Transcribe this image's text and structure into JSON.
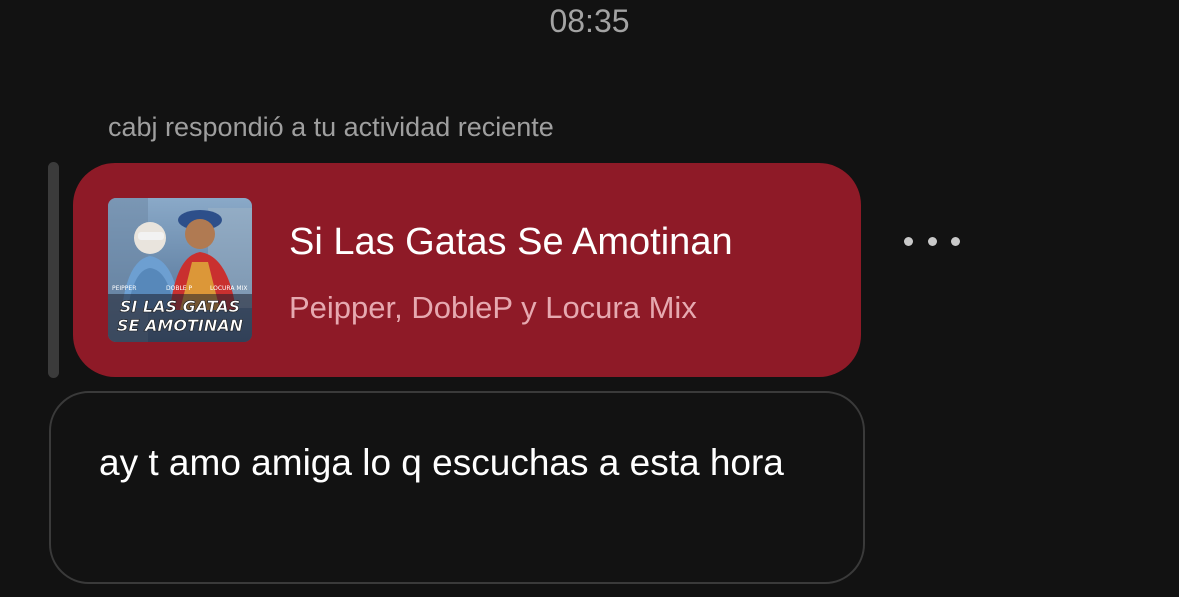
{
  "chat": {
    "timestamp": "08:35",
    "reply_context": "cabj respondió a tu actividad reciente"
  },
  "song_card": {
    "title": "Si Las Gatas Se Amotinan",
    "artists": "Peipper, DobleP y Locura Mix",
    "card_color": "#8e1a27",
    "cover": {
      "artist_labels": [
        "PEIPPER",
        "DOBLE P",
        "LOCURA MIX"
      ],
      "line1": "SI LAS GATAS",
      "line2": "SE AMOTINAN"
    }
  },
  "more_options": {
    "icon": "more-horizontal-icon"
  },
  "message": {
    "text": "ay t amo amiga lo q escuchas a esta hora"
  }
}
